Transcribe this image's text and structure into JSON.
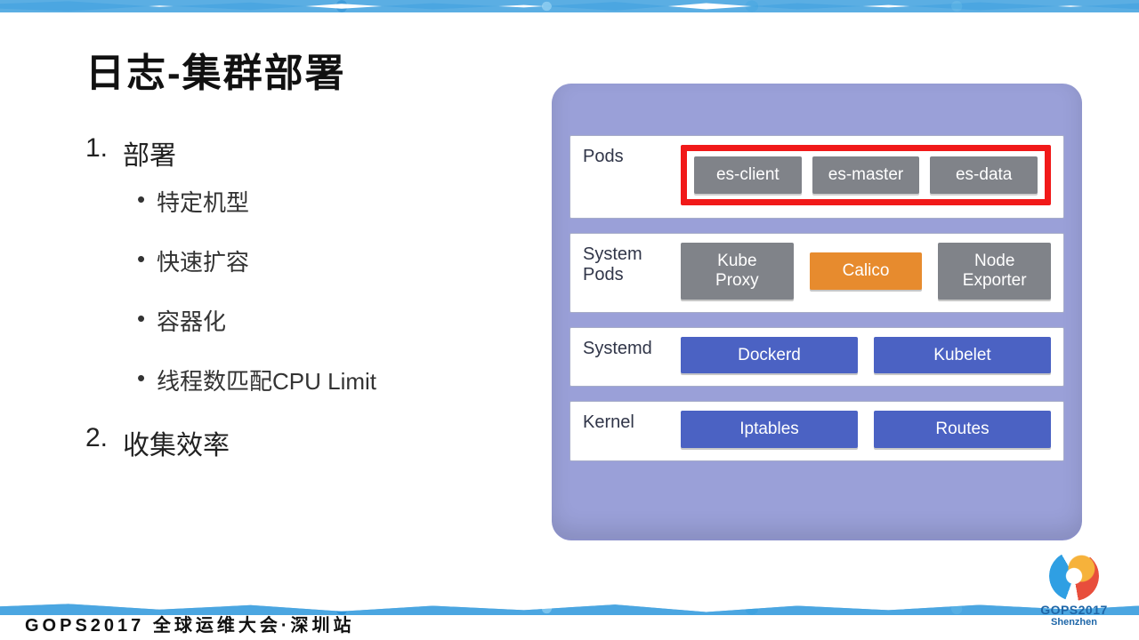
{
  "title": "日志-集群部署",
  "content": {
    "items": [
      {
        "num": "1.",
        "label": "部署",
        "bullets": [
          "特定机型",
          "快速扩容",
          "容器化",
          "线程数匹配CPU Limit"
        ]
      },
      {
        "num": "2.",
        "label": "收集效率",
        "bullets": []
      }
    ]
  },
  "diagram": {
    "layers": [
      {
        "name": "Pods",
        "highlight": true,
        "boxes": [
          {
            "label": "es-client",
            "style": "gray"
          },
          {
            "label": "es-master",
            "style": "gray"
          },
          {
            "label": "es-data",
            "style": "gray"
          }
        ]
      },
      {
        "name": "System\nPods",
        "highlight": false,
        "boxes": [
          {
            "label": "Kube\nProxy",
            "style": "gray"
          },
          {
            "label": "Calico",
            "style": "orange"
          },
          {
            "label": "Node\nExporter",
            "style": "gray"
          }
        ]
      },
      {
        "name": "Systemd",
        "highlight": false,
        "boxes": [
          {
            "label": "Dockerd",
            "style": "blue"
          },
          {
            "label": "Kubelet",
            "style": "blue"
          }
        ]
      },
      {
        "name": "Kernel",
        "highlight": false,
        "boxes": [
          {
            "label": "Iptables",
            "style": "blue"
          },
          {
            "label": "Routes",
            "style": "blue"
          }
        ]
      }
    ]
  },
  "footer": "GOPS2017 全球运维大会·深圳站",
  "logo": {
    "line1": "GOPS2017",
    "line2": "Shenzhen"
  }
}
